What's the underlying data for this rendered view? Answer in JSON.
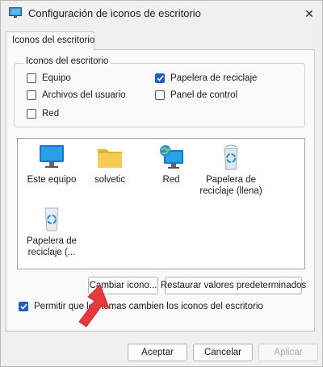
{
  "window": {
    "title": "Configuración de iconos de escritorio",
    "close_glyph": "✕"
  },
  "tabs": [
    {
      "label": "Iconos del escritorio"
    }
  ],
  "group": {
    "legend": "Iconos del escritorio",
    "checkboxes": [
      {
        "label": "Equipo",
        "checked": false
      },
      {
        "label": "Papelera de reciclaje",
        "checked": true
      },
      {
        "label": "Archivos del usuario",
        "checked": false
      },
      {
        "label": "Panel de control",
        "checked": false
      },
      {
        "label": "Red",
        "checked": false
      }
    ]
  },
  "icons": [
    {
      "label": "Este equipo",
      "icon": "monitor-icon"
    },
    {
      "label": "solvetic",
      "icon": "folder-icon"
    },
    {
      "label": "Red",
      "icon": "network-icon"
    },
    {
      "label": "Papelera de reciclaje (llena)",
      "icon": "recycle-bin-full-icon"
    },
    {
      "label": "Papelera de reciclaje (...",
      "icon": "recycle-bin-empty-icon"
    }
  ],
  "buttons": {
    "change_icon": "Cambiar icono...",
    "restore_defaults": "Restaurar valores predeterminados",
    "accept": "Aceptar",
    "cancel": "Cancelar",
    "apply": "Aplicar"
  },
  "allow_themes": {
    "label": "Permitir que los temas cambien los iconos del escritorio",
    "checked": true
  },
  "colors": {
    "accent": "#1f5fbf",
    "arrow": "#e8393f"
  }
}
